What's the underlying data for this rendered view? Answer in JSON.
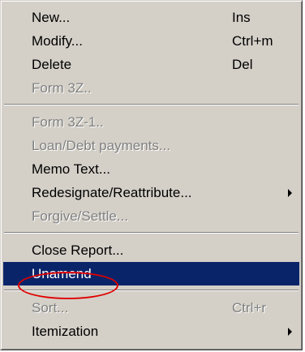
{
  "menu": {
    "group1": [
      {
        "label": "New...",
        "shortcut": "Ins"
      },
      {
        "label": "Modify...",
        "shortcut": "Ctrl+m"
      },
      {
        "label": "Delete",
        "shortcut": "Del"
      },
      {
        "label": "Form 3Z..",
        "shortcut": ""
      }
    ],
    "group2": [
      {
        "label": "Form 3Z-1..",
        "shortcut": ""
      },
      {
        "label": "Loan/Debt payments...",
        "shortcut": ""
      },
      {
        "label": "Memo Text...",
        "shortcut": ""
      },
      {
        "label": "Redesignate/Reattribute...",
        "shortcut": ""
      },
      {
        "label": "Forgive/Settle...",
        "shortcut": ""
      }
    ],
    "group3": [
      {
        "label": "Close Report...",
        "shortcut": ""
      },
      {
        "label": "Unamend",
        "shortcut": ""
      }
    ],
    "group4": [
      {
        "label": "Sort...",
        "shortcut": "Ctrl+r"
      },
      {
        "label": "Itemization",
        "shortcut": ""
      }
    ]
  },
  "colors": {
    "menu_bg": "#d4d0c8",
    "highlight": "#0a246a",
    "annotation": "#e00000"
  }
}
